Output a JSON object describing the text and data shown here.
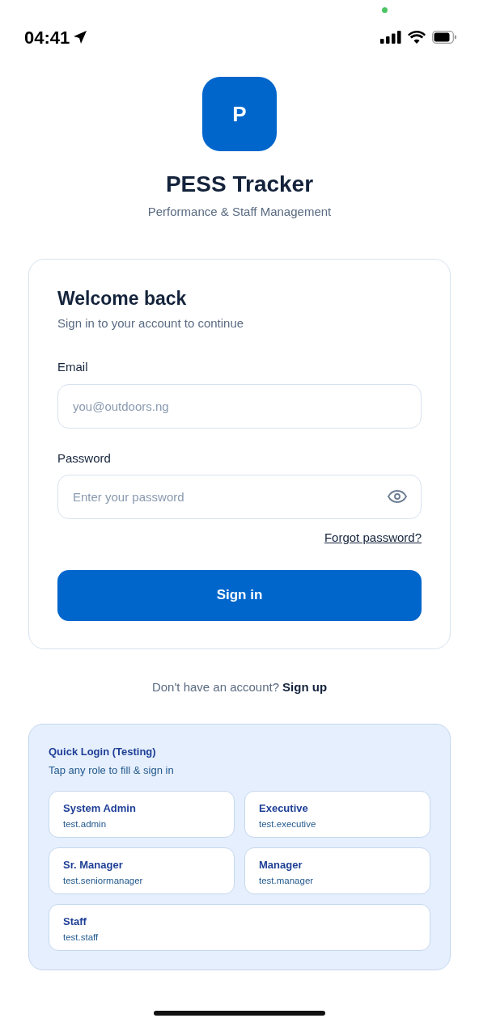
{
  "status_bar": {
    "time": "04:41"
  },
  "app": {
    "logo_letter": "P",
    "title": "PESS Tracker",
    "subtitle": "Performance & Staff Management"
  },
  "login_card": {
    "heading": "Welcome back",
    "subheading": "Sign in to your account to continue",
    "email": {
      "label": "Email",
      "placeholder": "you@outdoors.ng"
    },
    "password": {
      "label": "Password",
      "placeholder": "Enter your password"
    },
    "forgot_link": "Forgot password?",
    "submit": "Sign in"
  },
  "signup": {
    "prompt": "Don't have an account?",
    "link": "Sign up"
  },
  "quick_login": {
    "title": "Quick Login (Testing)",
    "hint": "Tap any role to fill & sign in",
    "roles": [
      {
        "name": "System Admin",
        "user": "test.admin"
      },
      {
        "name": "Executive",
        "user": "test.executive"
      },
      {
        "name": "Sr. Manager",
        "user": "test.seniormanager"
      },
      {
        "name": "Manager",
        "user": "test.manager"
      },
      {
        "name": "Staff",
        "user": "test.staff"
      }
    ]
  }
}
